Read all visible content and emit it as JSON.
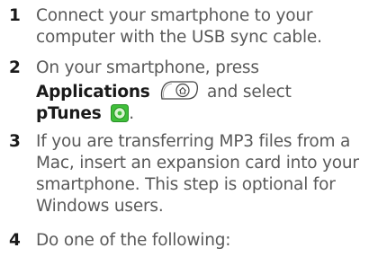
{
  "steps": [
    {
      "number": "1",
      "lines": [
        "Connect your smartphone to your",
        "computer with the USB sync cable."
      ]
    },
    {
      "number": "2",
      "line1": "On your smartphone, press",
      "applications_label": "Applications",
      "and_select": "and select",
      "ptunes_label": "pTunes",
      "period": "."
    },
    {
      "number": "3",
      "lines": [
        "If you are transferring MP3 files from a",
        "Mac, insert an expansion card into your",
        "smartphone. This step is optional for",
        "Windows users."
      ]
    },
    {
      "number": "4",
      "lines": [
        "Do one of the following:"
      ]
    }
  ],
  "icons": {
    "applications_key": "home-key-icon",
    "ptunes_app": "ptunes-app-icon",
    "ptunes_color": "#3fbf3a"
  }
}
